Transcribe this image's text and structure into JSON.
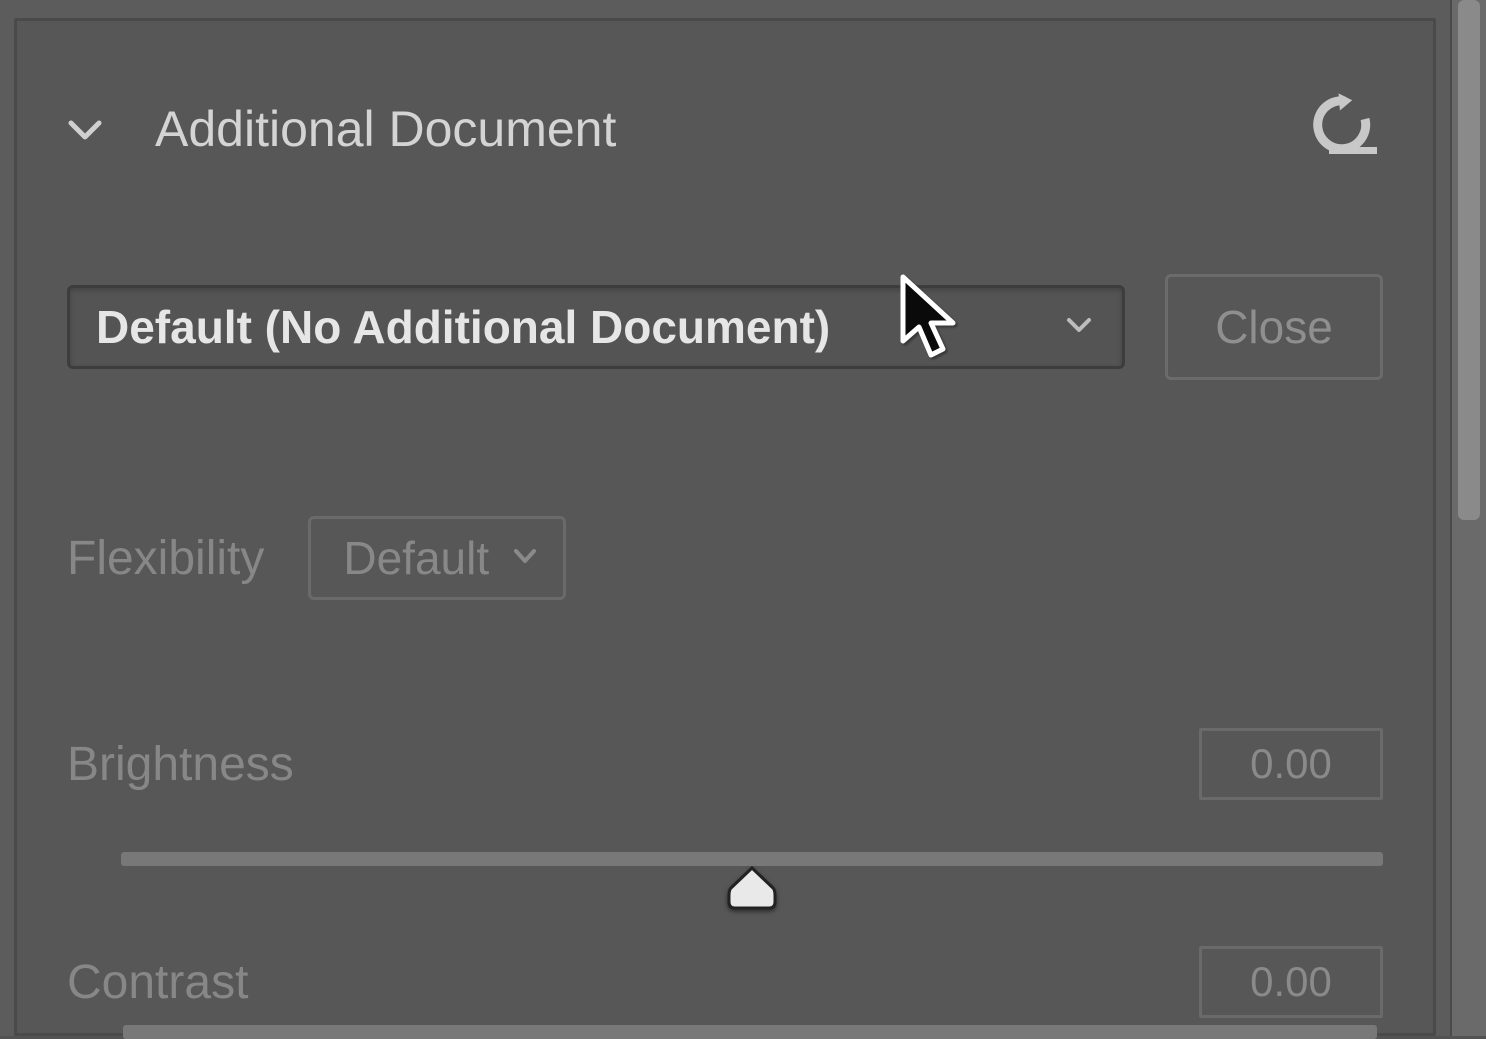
{
  "panel": {
    "title": "Additional Document"
  },
  "document_dropdown": {
    "selected": "Default (No Additional Document)"
  },
  "close_button": {
    "label": "Close"
  },
  "flexibility": {
    "label": "Flexibility",
    "selected": "Default"
  },
  "brightness": {
    "label": "Brightness",
    "value": "0.00"
  },
  "contrast": {
    "label": "Contrast",
    "value": "0.00"
  }
}
